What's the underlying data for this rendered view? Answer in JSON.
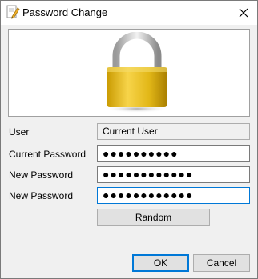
{
  "window": {
    "title": "Password Change",
    "close_icon": "close-icon"
  },
  "form": {
    "user_label": "User",
    "user_value": "Current User",
    "current_password_label": "Current Password",
    "current_password_value": "●●●●●●●●●●",
    "new_password_label": "New Password",
    "new_password_value": "●●●●●●●●●●●●",
    "confirm_password_label": "New Password",
    "confirm_password_value": "●●●●●●●●●●●●"
  },
  "buttons": {
    "random": "Random",
    "ok": "OK",
    "cancel": "Cancel"
  },
  "colors": {
    "focus_accent": "#0078d7",
    "lock_body": "#e2b717",
    "lock_shackle": "#c8c8c8"
  }
}
